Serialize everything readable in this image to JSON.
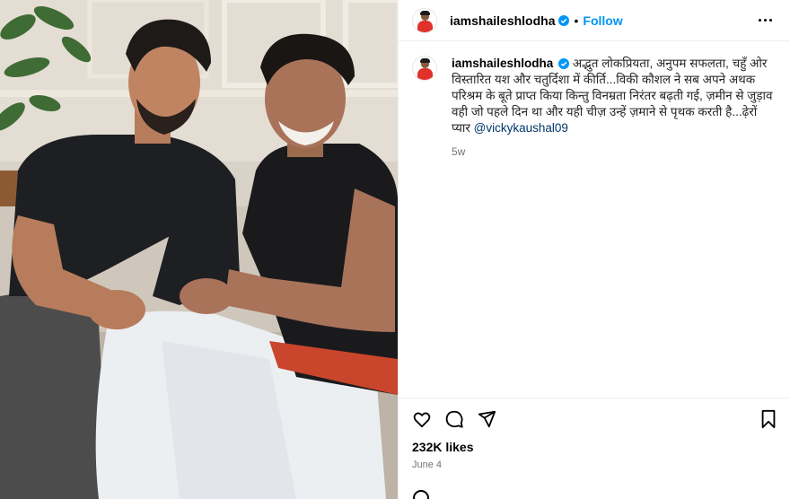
{
  "post": {
    "username": "iamshaileshlodha",
    "follow_label": "Follow",
    "separator": "•",
    "caption_text": " अद्भुत लोकप्रियता, अनुपम सफलता, चहुँ ओर विस्तारित यश और चतुर्दिशा में कीर्ति...विकी कौशल ने सब अपने अथक परिश्रम के बूते प्राप्त किया किन्तु विनम्रता निरंतर बढ़ती गई, ज़मीन से जुड़ाव वही जो पहले दिन था और यही चीज़ उन्हें ज़माने से पृथक करती है...ढ़ेरों प्यार ",
    "mention": "@vickykaushal09",
    "posted_ago": "5w",
    "likes": "232K likes",
    "date": "June 4"
  },
  "icons": {
    "more": "more-options-icon",
    "like": "heart-icon",
    "comment": "comment-icon",
    "share": "share-icon",
    "save": "bookmark-icon",
    "verified": "verified-badge-icon"
  },
  "colors": {
    "follow": "#0095f6",
    "mention": "#00376b",
    "verified": "#0095f6",
    "muted": "#737373"
  }
}
